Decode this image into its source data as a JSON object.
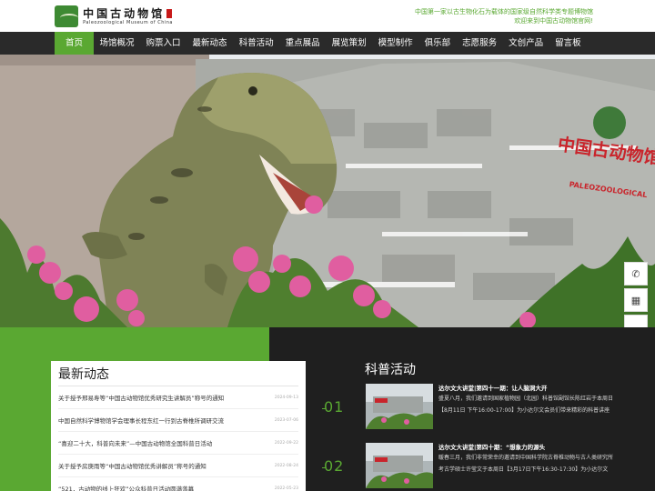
{
  "header": {
    "logo_cn": "中国古动物馆",
    "logo_en": "Paleozoological Museum of China",
    "tagline_line1": "中国第一家以古生物化石为载体的国家级自然科学类专题博物馆",
    "tagline_line2": "欢迎来到中国古动物馆官网!"
  },
  "nav": {
    "items": [
      "首页",
      "场馆概况",
      "购票入口",
      "最新动态",
      "科普活动",
      "重点展品",
      "展览策划",
      "模型制作",
      "俱乐部",
      "志愿服务",
      "文创产品",
      "留言板"
    ],
    "active_index": 0
  },
  "banner": {
    "building_sign": "中国古动物馆",
    "building_sign_en": "PALEOZOOLOGICAL"
  },
  "side_tools": {
    "items": [
      {
        "name": "phone-icon",
        "glyph": "✆"
      },
      {
        "name": "qrcode-icon",
        "glyph": "▦"
      },
      {
        "name": "back-to-top-icon",
        "glyph": "︿"
      }
    ]
  },
  "news": {
    "title": "最新动态",
    "items": [
      {
        "text": "关于授予邢易寿等“中国古动物馆优秀研究生讲解员”称号的通知",
        "date": "2024-09-13"
      },
      {
        "text": "中国自然科学博物馆学会理事长程东红一行到古脊椎所调研交流",
        "date": "2023-07-06"
      },
      {
        "text": "“喜迎二十大，科普向未来”—中国古动物馆全国科普日活动",
        "date": "2022-09-22"
      },
      {
        "text": "关于授予房庚雨等“中国古动物馆优秀讲解员”称号的通知",
        "date": "2022-08-24"
      },
      {
        "text": "“521，古动物的线上狂欢”公众科普日活动圆满落幕",
        "date": "2022-05-23"
      }
    ]
  },
  "activities": {
    "title": "科普活动",
    "items": [
      {
        "num": "01",
        "title": "达尔文大讲堂|第四十一期：让人脑洞大开",
        "desc": "盛夏八月，我们邀请到国家植物园（北园）科普馆副馆长陈红岩于本周日【8月11日 下午16:00-17:00】为小达尔文会员们带来精彩的科普讲座"
      },
      {
        "num": "02",
        "title": "达尔文大讲堂|第四十期：“想象力的源头",
        "desc": "暖春三月，我们非常荣幸的邀请到中国科学院古脊椎动物与古人类研究所考古学硕士许莹文于本周日【3月17日下午16:30-17:30】为小达尔文"
      }
    ]
  },
  "colors": {
    "brand_green": "#5aa832",
    "nav_dark": "#2a2a2a",
    "activity_bg": "#1f1f1f"
  }
}
